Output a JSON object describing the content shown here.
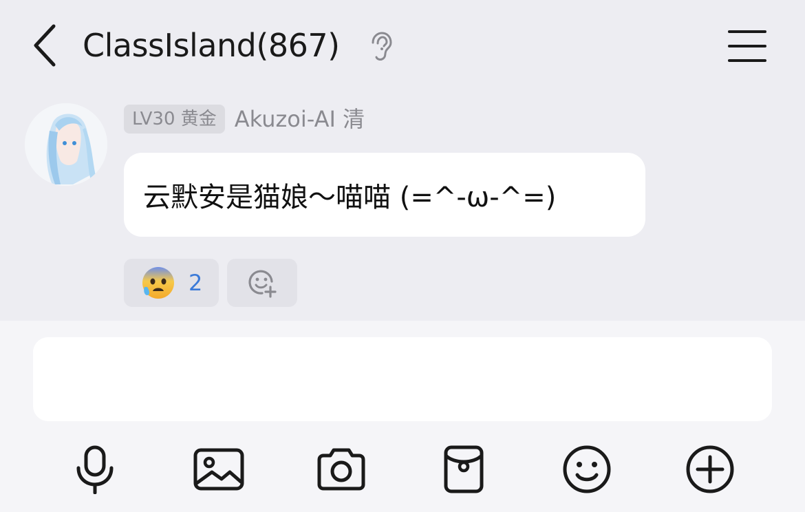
{
  "header": {
    "title": "ClassIsland(867)",
    "back_icon": "chevron-left-icon",
    "ear_icon": "ear-icon",
    "menu_icon": "hamburger-menu-icon"
  },
  "message": {
    "level_badge": "LV30 黄金",
    "sender_name": "Akuzoi-AI 清",
    "text": "云默安是猫娘～喵喵 (=^-ω-^=)",
    "reaction": {
      "emoji": "😰",
      "count": "2"
    }
  },
  "input": {
    "placeholder": "",
    "value": ""
  },
  "toolbar": [
    "microphone-icon",
    "image-icon",
    "camera-icon",
    "red-packet-icon",
    "emoji-icon",
    "plus-circle-icon"
  ],
  "colors": {
    "accent": "#3b7ad8",
    "background": "#ededf2",
    "bubble": "#ffffff"
  }
}
